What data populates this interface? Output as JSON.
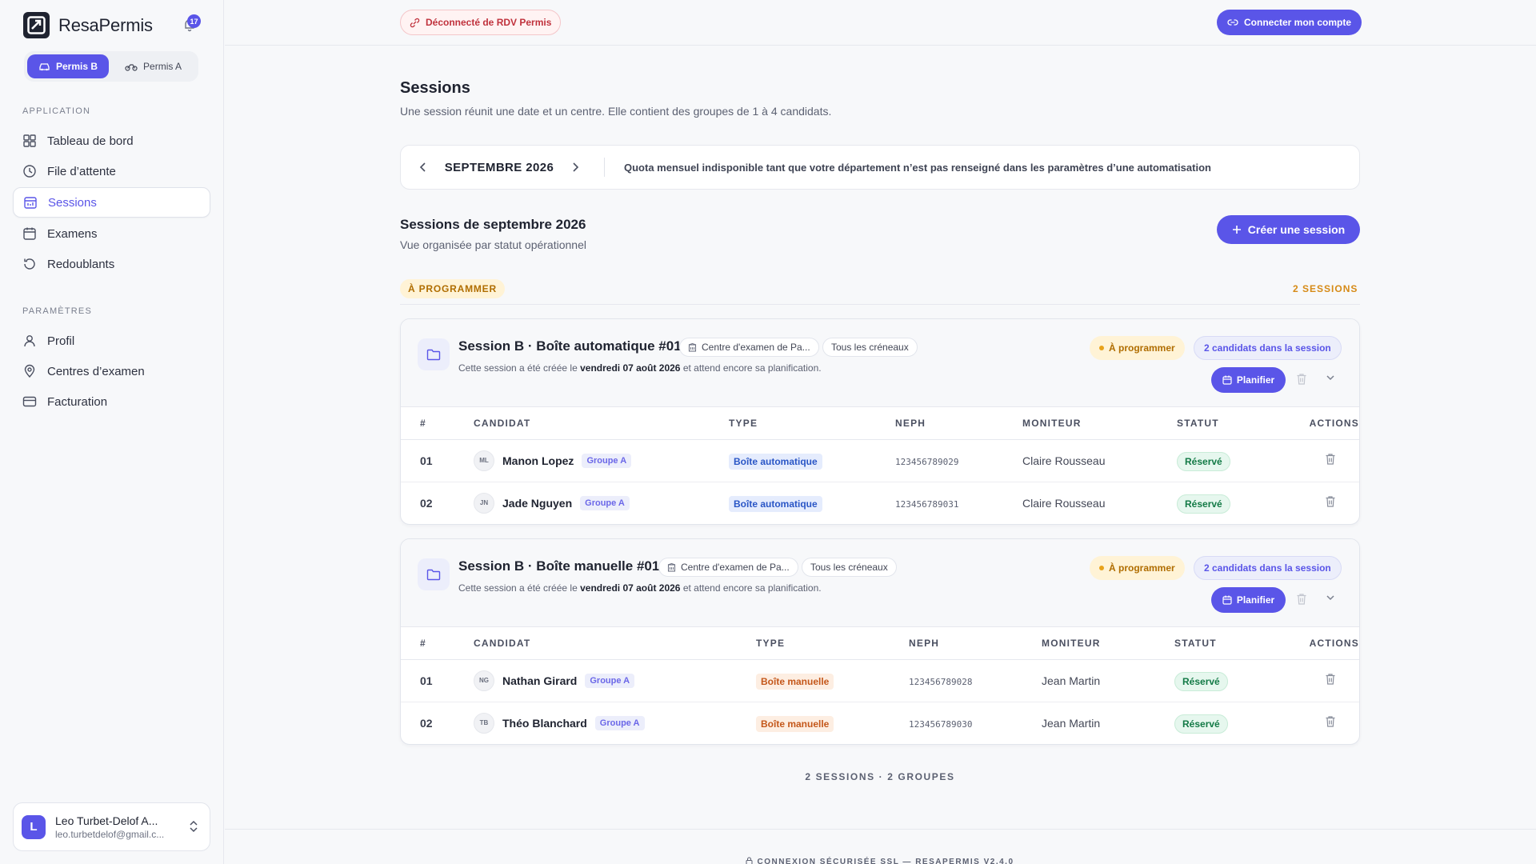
{
  "brand": {
    "name": "ResaPermis",
    "notifications": "17"
  },
  "permis": {
    "b": "Permis B",
    "a": "Permis A"
  },
  "sidebar": {
    "section_app": "APPLICATION",
    "section_params": "PARAMÈTRES",
    "app_items": [
      {
        "label": "Tableau de bord",
        "icon": "grid-icon"
      },
      {
        "label": "File d’attente",
        "icon": "clock-icon"
      },
      {
        "label": "Sessions",
        "icon": "calendar-sessions-icon"
      },
      {
        "label": "Examens",
        "icon": "calendar-icon"
      },
      {
        "label": "Redoublants",
        "icon": "rotate-icon"
      }
    ],
    "param_items": [
      {
        "label": "Profil",
        "icon": "user-icon"
      },
      {
        "label": "Centres d’examen",
        "icon": "map-pin-icon"
      },
      {
        "label": "Facturation",
        "icon": "credit-card-icon"
      }
    ]
  },
  "user": {
    "initial": "L",
    "name": "Leo Turbet-Delof A...",
    "email": "leo.turbetdelof@gmail.c..."
  },
  "topbar": {
    "disconnected": "Déconnecté de RDV Permis",
    "connect": "Connecter mon compte"
  },
  "page": {
    "title": "Sessions",
    "subtitle": "Une session réunit une date et un centre. Elle contient des groupes de 1 à 4 candidats."
  },
  "month_bar": {
    "month": "SEPTEMBRE 2026",
    "quota": "Quota mensuel indisponible tant que votre département n’est pas renseigné dans les paramètres d’une automatisation"
  },
  "section": {
    "title": "Sessions de septembre 2026",
    "subtitle": "Vue organisée par statut opérationnel",
    "create": "Créer une session",
    "status": "À PROGRAMMER",
    "count": "2 SESSIONS"
  },
  "table_headers": [
    "#",
    "CANDIDAT",
    "TYPE",
    "NEPH",
    "MONITEUR",
    "STATUT",
    "ACTIONS"
  ],
  "sessions": [
    {
      "name": "Session B · Boîte automatique #01",
      "centre": "Centre d'examen de Pa...",
      "creneaux": "Tous les créneaux",
      "desc_prefix": "Cette session a été créée le ",
      "desc_date": "vendredi 07 août 2026",
      "desc_suffix": " et attend encore sa planification.",
      "status_badge": "À programmer",
      "candidates_badge": "2 candidats dans la session",
      "plan": "Planifier",
      "rows": [
        {
          "num": "01",
          "initials": "ML",
          "name": "Manon Lopez",
          "group": "Groupe A",
          "type": "Boîte automatique",
          "neph": "123456789029",
          "moniteur": "Claire Rousseau",
          "status": "Réservé"
        },
        {
          "num": "02",
          "initials": "JN",
          "name": "Jade Nguyen",
          "group": "Groupe A",
          "type": "Boîte automatique",
          "neph": "123456789031",
          "moniteur": "Claire Rousseau",
          "status": "Réservé"
        }
      ]
    },
    {
      "name": "Session B · Boîte manuelle #01",
      "centre": "Centre d'examen de Pa...",
      "creneaux": "Tous les créneaux",
      "desc_prefix": "Cette session a été créée le ",
      "desc_date": "vendredi 07 août 2026",
      "desc_suffix": " et attend encore sa planification.",
      "status_badge": "À programmer",
      "candidates_badge": "2 candidats dans la session",
      "plan": "Planifier",
      "rows": [
        {
          "num": "01",
          "initials": "NG",
          "name": "Nathan Girard",
          "group": "Groupe A",
          "type": "Boîte manuelle",
          "neph": "123456789028",
          "moniteur": "Jean Martin",
          "status": "Réservé"
        },
        {
          "num": "02",
          "initials": "TB",
          "name": "Théo Blanchard",
          "group": "Groupe A",
          "type": "Boîte manuelle",
          "neph": "123456789030",
          "moniteur": "Jean Martin",
          "status": "Réservé"
        }
      ]
    }
  ],
  "footer": {
    "count": "2 SESSIONS · 2 GROUPES",
    "ssl": "CONNEXION SÉCURISÉE SSL — RESAPERMIS V2.4.0"
  },
  "colors": {
    "accent": "#5a55e8",
    "warning": "#b06d00",
    "success": "#137a46",
    "danger": "#c0323d"
  }
}
